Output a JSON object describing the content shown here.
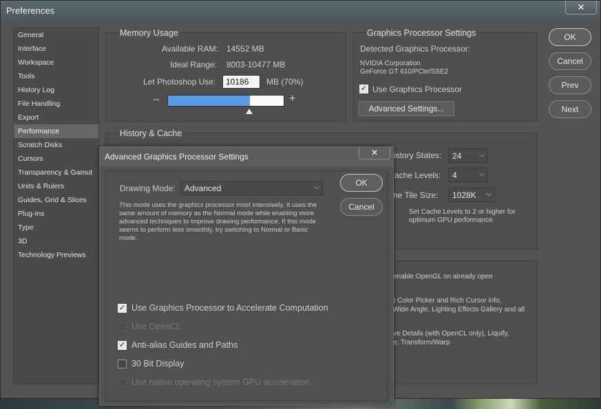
{
  "window": {
    "title": "Preferences",
    "close_glyph": "✕"
  },
  "nav": {
    "items": [
      "General",
      "Interface",
      "Workspace",
      "Tools",
      "History Log",
      "File Handling",
      "Export",
      "Performance",
      "Scratch Disks",
      "Cursors",
      "Transparency & Gamut",
      "Units & Rulers",
      "Guides, Grid & Slices",
      "Plug-Ins",
      "Type",
      "3D",
      "Technology Previews"
    ],
    "selected": "Performance"
  },
  "memory": {
    "title": "Memory Usage",
    "available_label": "Available RAM:",
    "available_value": "14552 MB",
    "ideal_label": "Ideal Range:",
    "ideal_value": "8003-10477 MB",
    "let_label": "Let Photoshop Use:",
    "let_value": "10186",
    "let_unit": "MB (70%)",
    "minus": "–",
    "plus": "+",
    "slider_fraction": 0.7
  },
  "gpu": {
    "title": "Graphics Processor Settings",
    "detected_label": "Detected Graphics Processor:",
    "vendor": "NVIDIA Corporation",
    "model": "GeForce GT 610/PCIe/SSE2",
    "use_gpu_label": "Use Graphics Processor",
    "use_gpu_checked": true,
    "advanced_button": "Advanced Settings..."
  },
  "right_buttons": {
    "ok": "OK",
    "cancel": "Cancel",
    "prev": "Prev",
    "next": "Next"
  },
  "history": {
    "title": "History & Cache",
    "states_label": "istory States:",
    "states_value": "24",
    "cache_label": "ache Levels:",
    "cache_value": "4",
    "tile_label": "he Tile Size:",
    "tile_value": "1028K",
    "note": "Set Cache Levels to 2 or higher for optimum GPU performance."
  },
  "bottom_group": {
    "line1": "enable OpenGL on already open",
    "line2": ") Color Picker and Rich Cursor info,",
    "line3": "Wide Angle, Lighting Effects Gallery and all",
    "line4": "ve Details (with OpenCL only), Liquify,",
    "line5": "e, Transform/Warp"
  },
  "dialog": {
    "title": "Advanced Graphics Processor Settings",
    "close_glyph": "✕",
    "drawing_mode_label": "Drawing Mode:",
    "drawing_mode_value": "Advanced",
    "description": "This mode uses the graphics processor most intensively.  It uses the same amount of memory as the Normal mode while enabling more advanced techniques to improve drawing performance.  If this mode seems to perform less smoothly, try switching to Normal or Basic mode.",
    "ok": "OK",
    "cancel": "Cancel",
    "options": [
      {
        "label": "Use Graphics Processor to Accelerate Computation",
        "checked": true,
        "disabled": false
      },
      {
        "label": "Use OpenCL",
        "checked": false,
        "disabled": true
      },
      {
        "label": "Anti-alias Guides and Paths",
        "checked": true,
        "disabled": false
      },
      {
        "label": "30 Bit Display",
        "checked": false,
        "disabled": false
      },
      {
        "label": "Use native operating system GPU acceleration",
        "checked": false,
        "disabled": true
      }
    ]
  },
  "glyphs": {
    "check": "✓",
    "chevron": "⌵"
  }
}
